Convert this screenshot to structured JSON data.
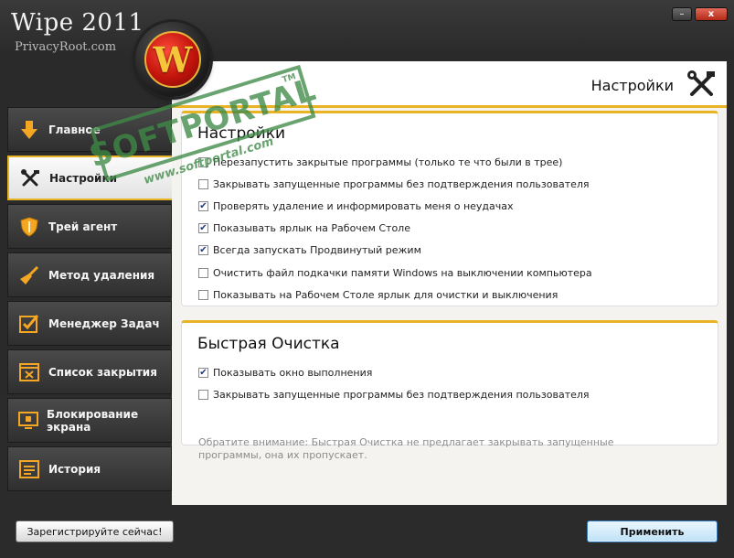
{
  "app": {
    "title": "Wipe 2011",
    "subtitle": "PrivacyRoot.com",
    "logo_letter": "W"
  },
  "window_controls": {
    "minimize": "–",
    "close": "x"
  },
  "sidebar": {
    "items": [
      {
        "label": "Главное",
        "icon": "download-arrow-icon"
      },
      {
        "label": "Настройки",
        "icon": "tools-icon",
        "active": true
      },
      {
        "label": "Трей агент",
        "icon": "shield-icon"
      },
      {
        "label": "Метод удаления",
        "icon": "broom-icon"
      },
      {
        "label": "Менеджер Задач",
        "icon": "checklist-icon"
      },
      {
        "label": "Список закрытия",
        "icon": "close-window-icon"
      },
      {
        "label": "Блокирование экрана",
        "icon": "monitor-lock-icon"
      },
      {
        "label": "История",
        "icon": "history-list-icon"
      }
    ]
  },
  "panel": {
    "title": "Настройки",
    "settings_group": {
      "title": "Настройки",
      "options": [
        {
          "label": "Перезапустить закрытые программы (только те что были в трее)",
          "checked": false
        },
        {
          "label": "Закрывать запущенные программы без подтверждения пользователя",
          "checked": false
        },
        {
          "label": "Проверять удаление и информировать меня о неудачах",
          "checked": true
        },
        {
          "label": "Показывать ярлык на Рабочем Столе",
          "checked": true
        },
        {
          "label": "Всегда запускать Продвинутый режим",
          "checked": true
        },
        {
          "label": "Очистить файл подкачки памяти Windows на выключении компьютера",
          "checked": false
        },
        {
          "label": "Показывать на Рабочем Столе ярлык для очистки и выключения",
          "checked": false
        }
      ]
    },
    "quick_group": {
      "title": "Быстрая Очистка",
      "options": [
        {
          "label": "Показывать окно выполнения",
          "checked": true
        },
        {
          "label": "Закрывать запущенные программы без подтверждения пользователя",
          "checked": false
        }
      ],
      "note": "Обратите внимание: Быстрая Очистка не предлагает закрывать запущенные программы, она их пропускает."
    }
  },
  "buttons": {
    "register": "Зарегистрируйте сейчас!",
    "apply": "Применить"
  },
  "watermark": {
    "text": "SOFTPORTAL",
    "tm": "TM",
    "url": "www.softportal.com"
  },
  "colors": {
    "accent": "#e8b325",
    "window_bg": "#2b2b2b",
    "watermark": "#3f8a47"
  }
}
